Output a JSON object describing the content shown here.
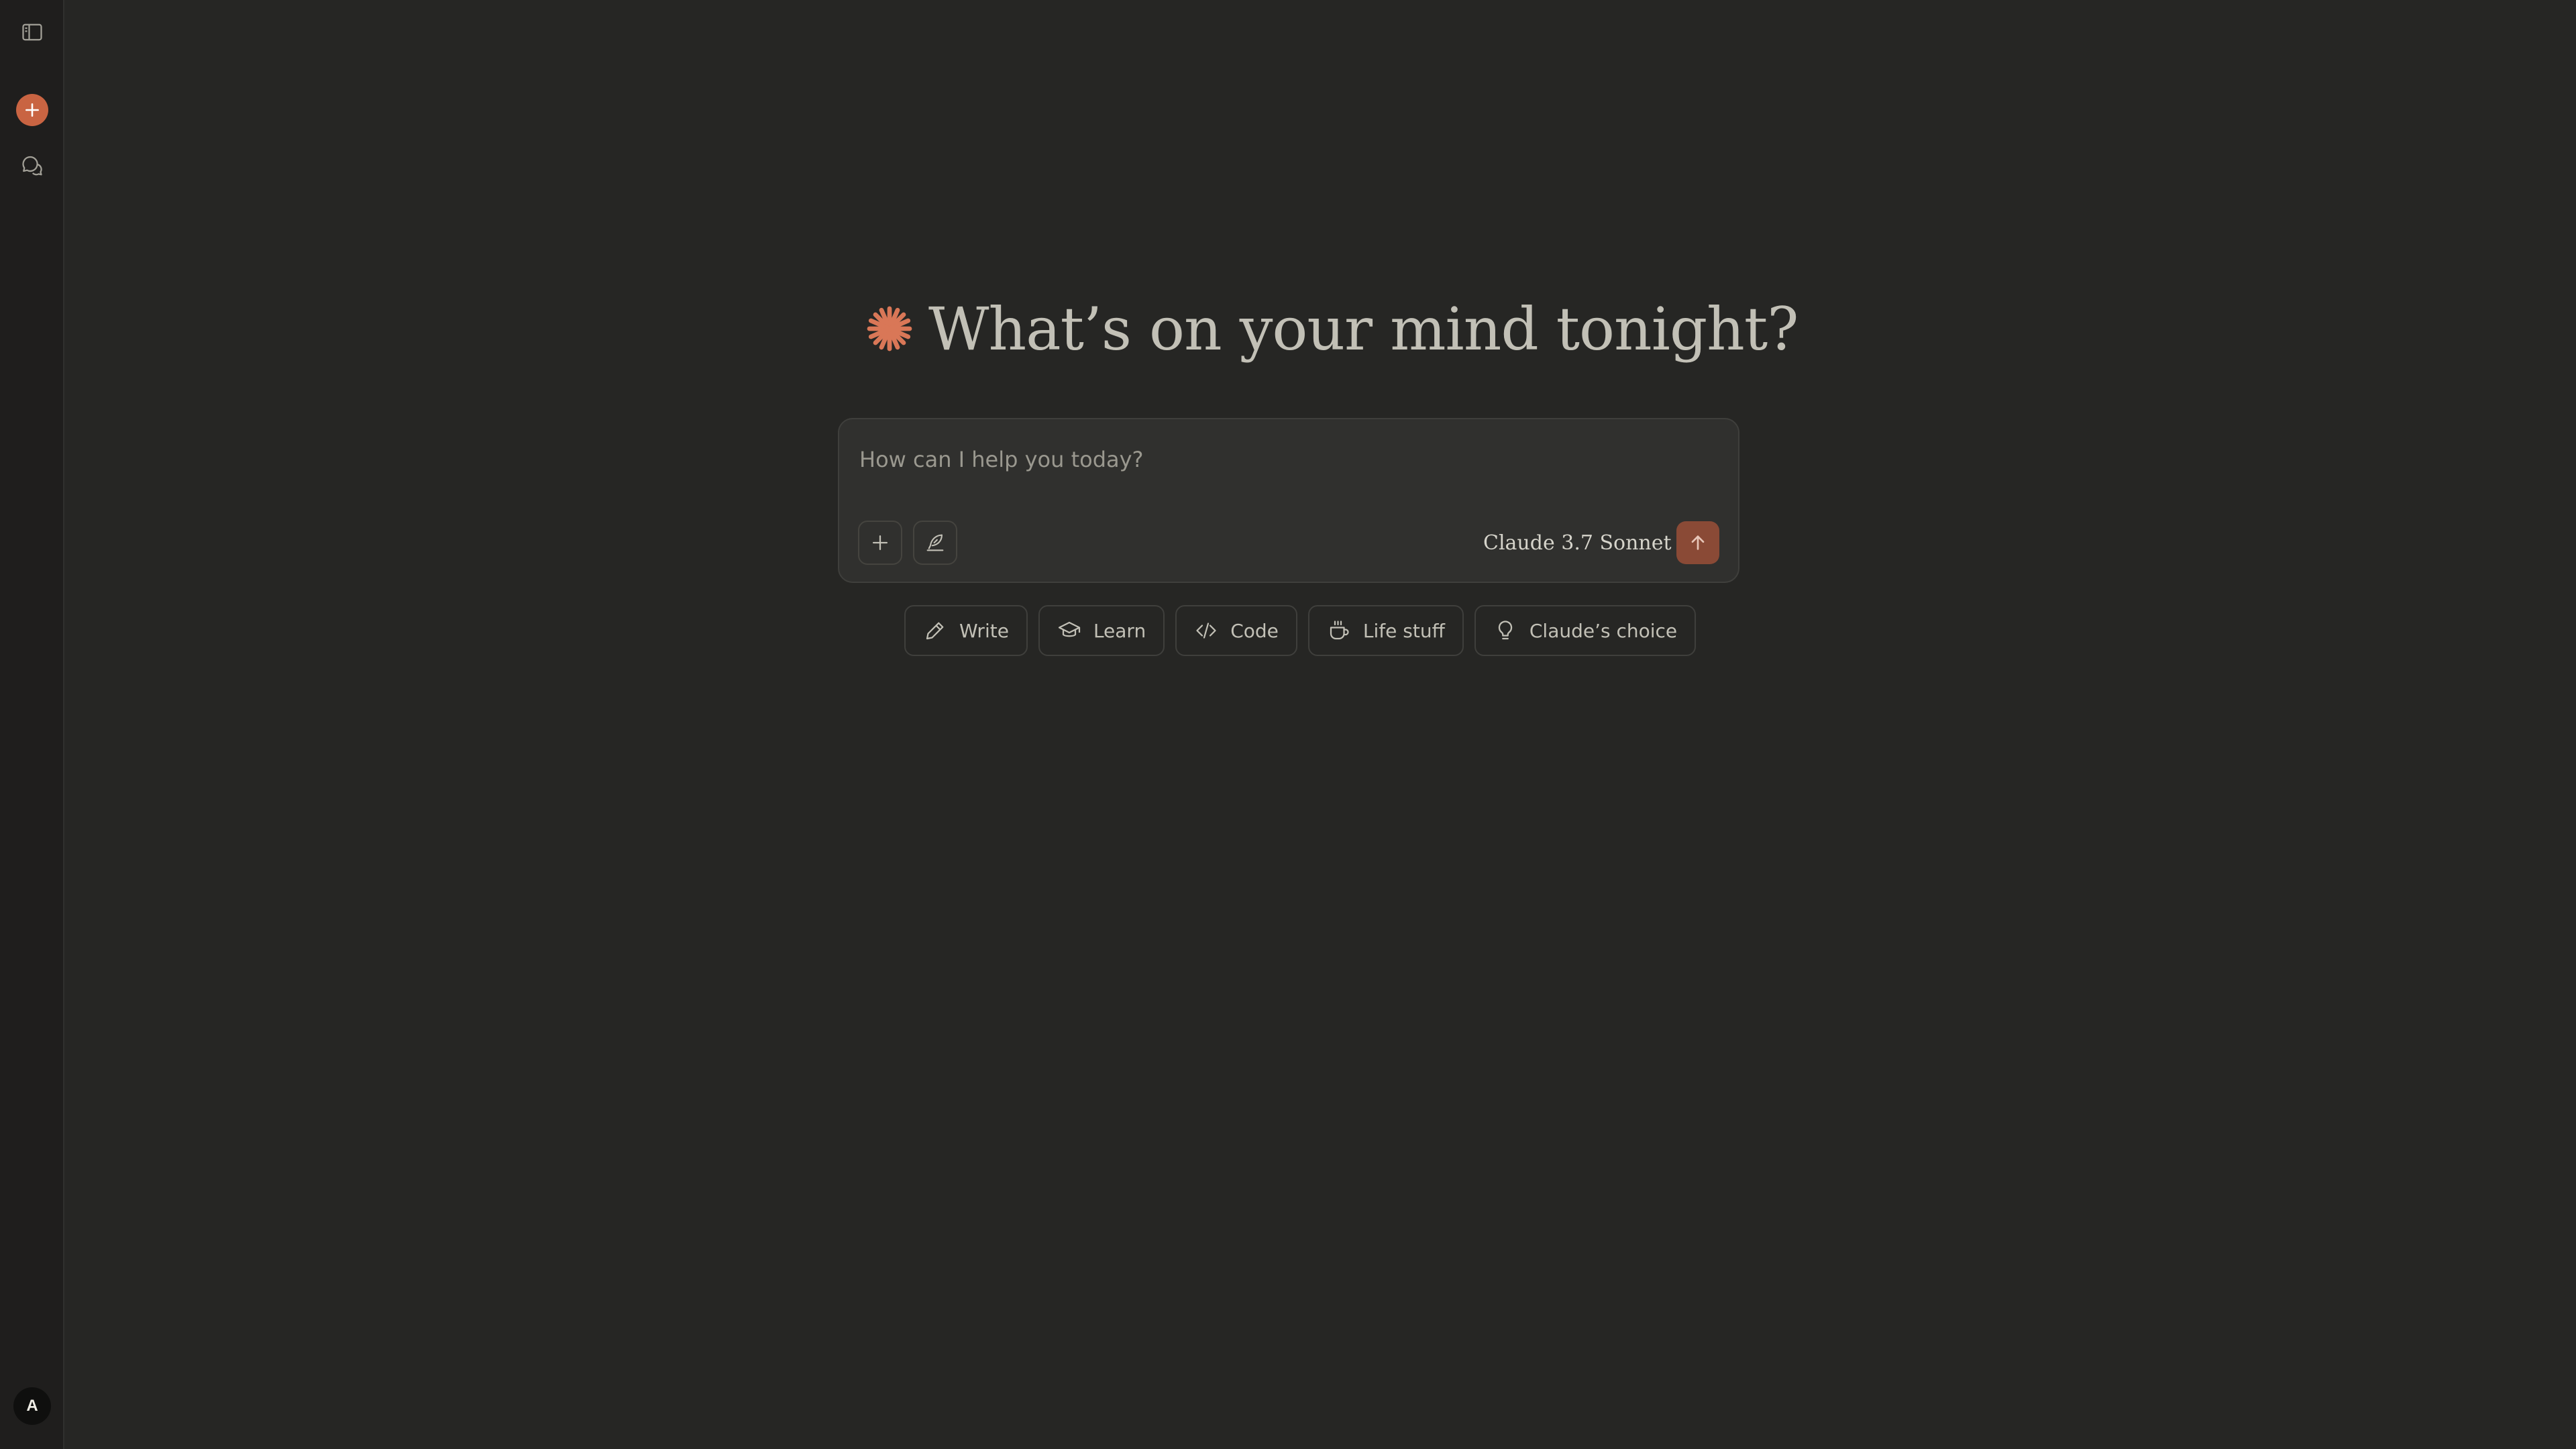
{
  "sidebar": {
    "toggle_icon": "sidebar-toggle-icon",
    "new_chat_icon": "plus-icon",
    "chats_icon": "chat-bubbles-icon",
    "avatar_initial": "A"
  },
  "greeting": {
    "icon": "claude-spark-icon",
    "text": "What’s on your mind tonight?"
  },
  "composer": {
    "placeholder": "How can I help you today?",
    "value": "",
    "model_label": "Claude 3.7 Sonnet"
  },
  "chips": [
    {
      "label": "Write",
      "icon": "pencil-icon"
    },
    {
      "label": "Learn",
      "icon": "graduation-cap-icon"
    },
    {
      "label": "Code",
      "icon": "code-icon"
    },
    {
      "label": "Life stuff",
      "icon": "coffee-icon"
    },
    {
      "label": "Claude’s choice",
      "icon": "lightbulb-icon"
    }
  ],
  "colors": {
    "background": "#262624",
    "rail": "#1f1e1d",
    "accent": "#c96442",
    "send": "#8a4a36",
    "text": "#c2c0b6"
  }
}
